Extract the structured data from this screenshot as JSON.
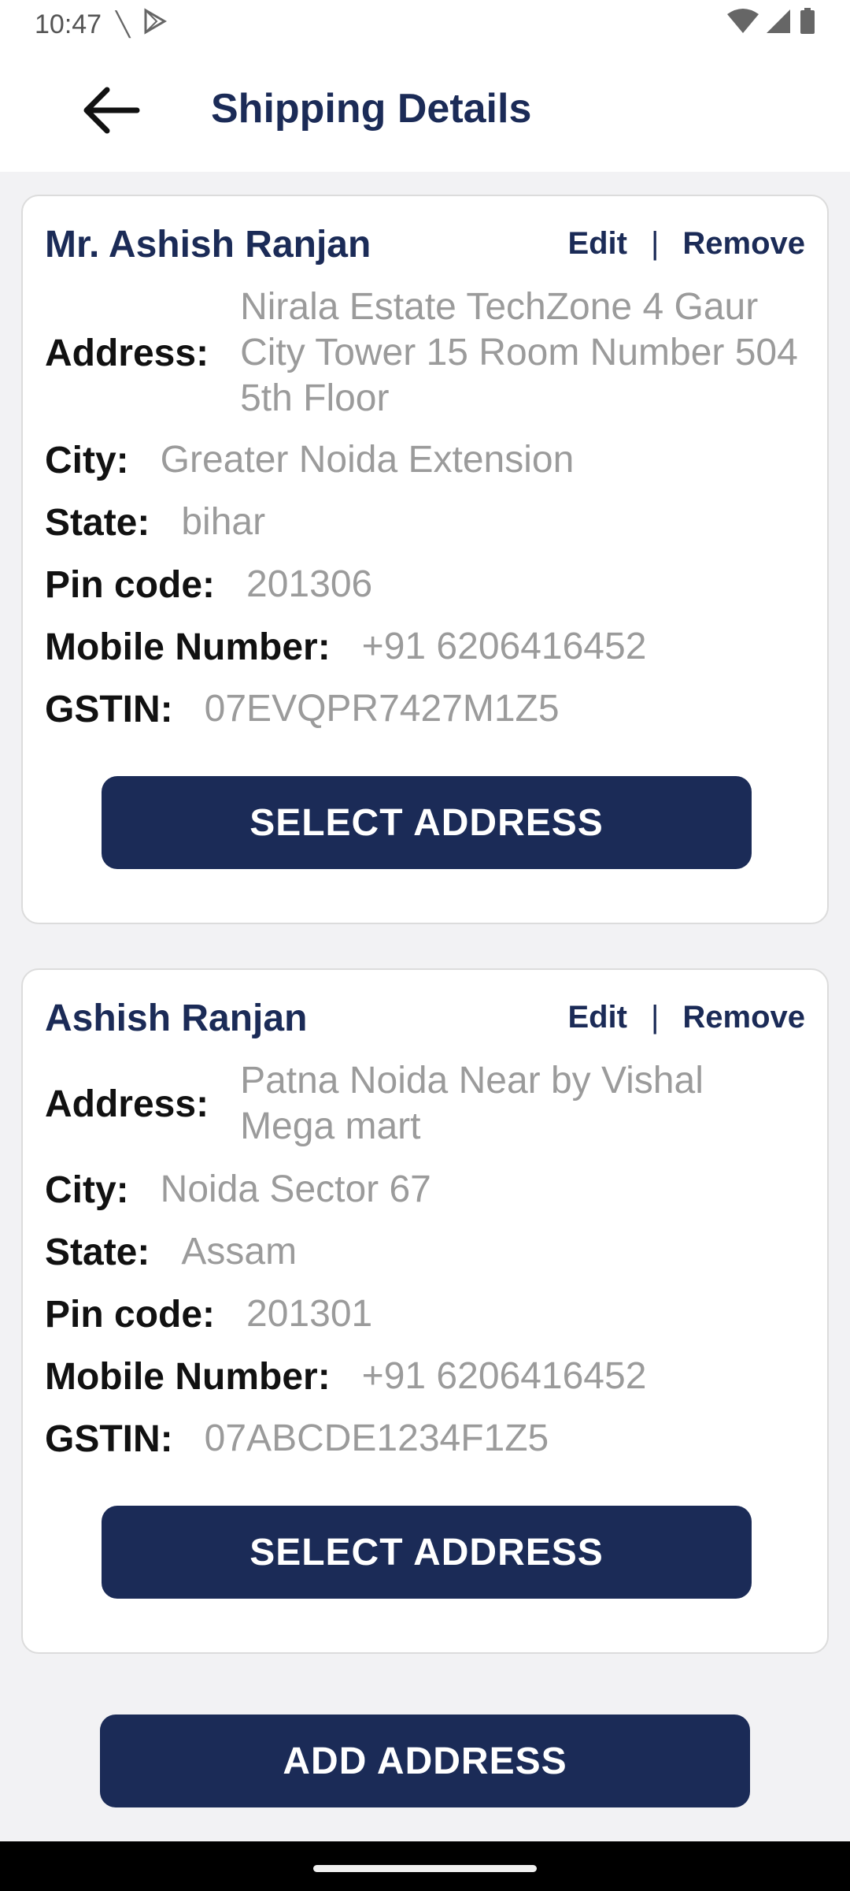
{
  "status_bar": {
    "time": "10:47",
    "icons": [
      "call-forward-icon",
      "play-store-icon",
      "wifi-icon",
      "signal-icon",
      "battery-icon"
    ]
  },
  "header": {
    "title": "Shipping Details",
    "back_icon": "arrow-left-icon"
  },
  "labels": {
    "address": "Address:",
    "city": "City:",
    "state": "State:",
    "pin": "Pin code:",
    "mobile": "Mobile Number:",
    "gstin": "GSTIN:",
    "edit": "Edit",
    "separator": "|",
    "remove": "Remove",
    "select_address": "SELECT ADDRESS",
    "add_address": "ADD ADDRESS"
  },
  "addresses": [
    {
      "name": "Mr. Ashish Ranjan",
      "address": "Nirala Estate TechZone 4 Gaur City Tower 15 Room Number 504 5th Floor",
      "city": "Greater Noida Extension",
      "state": "bihar",
      "pin": "201306",
      "mobile": "+91 6206416452",
      "gstin": "07EVQPR7427M1Z5"
    },
    {
      "name": "Ashish Ranjan",
      "address": "Patna Noida Near by Vishal Mega mart",
      "city": "Noida Sector 67",
      "state": "Assam",
      "pin": "201301",
      "mobile": "+91 6206416452",
      "gstin": "07ABCDE1234F1Z5"
    }
  ],
  "colors": {
    "brand": "#1b2b57",
    "value_text": "#9b9b9b",
    "background": "#f2f2f4"
  }
}
